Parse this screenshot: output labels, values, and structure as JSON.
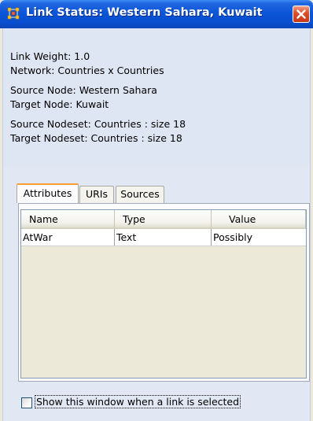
{
  "window": {
    "title": "Link Status: Western Sahara, Kuwait"
  },
  "title_icon": "network-grid-icon",
  "close_icon": "close-icon",
  "info": {
    "link_weight": "Link Weight: 1.0",
    "network": "Network: Countries x Countries",
    "source_node": "Source Node: Western Sahara",
    "target_node": "Target Node: Kuwait",
    "source_nodeset": "Source Nodeset: Countries : size 18",
    "target_nodeset": "Target Nodeset: Countries : size 18"
  },
  "tabs": [
    {
      "label": "Attributes",
      "active": true
    },
    {
      "label": "URIs",
      "active": false
    },
    {
      "label": "Sources",
      "active": false
    }
  ],
  "table": {
    "columns": [
      "Name",
      "Type",
      "Value"
    ],
    "rows": [
      [
        "AtWar",
        "Text",
        "Possibly"
      ]
    ]
  },
  "footer": {
    "checkbox_label": "Show this window when a link is selected",
    "checkbox_checked": false
  },
  "colors": {
    "title_bar": "#0a54d6",
    "close_button": "#e0502a",
    "active_tab_accent": "#ff9c31",
    "panel_background": "#dfe6f3"
  }
}
